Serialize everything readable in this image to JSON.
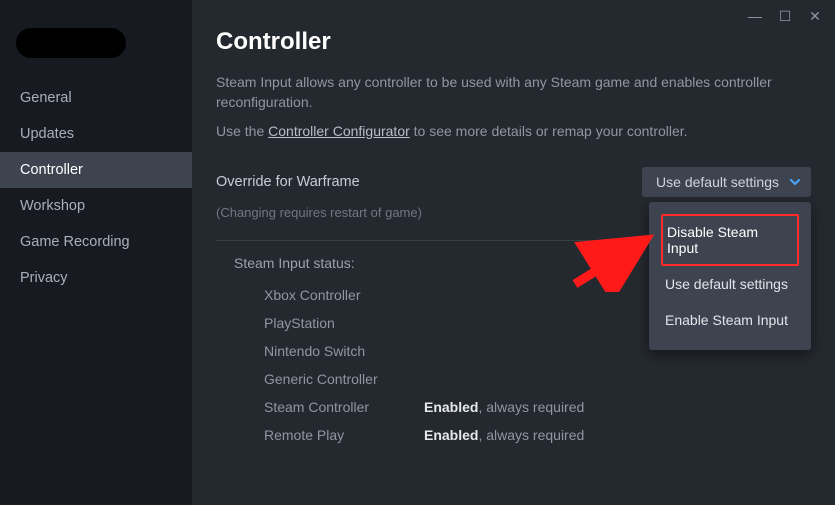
{
  "titlebar": {
    "minimize": "—",
    "maximize": "☐",
    "close": "✕"
  },
  "sidebar": {
    "items": [
      {
        "label": "General"
      },
      {
        "label": "Updates"
      },
      {
        "label": "Controller"
      },
      {
        "label": "Workshop"
      },
      {
        "label": "Game Recording"
      },
      {
        "label": "Privacy"
      }
    ]
  },
  "main": {
    "title": "Controller",
    "desc1": "Steam Input allows any controller to be used with any Steam game and enables controller reconfiguration.",
    "desc2_prefix": "Use the ",
    "desc2_link": "Controller Configurator",
    "desc2_suffix": " to see more details or remap your controller.",
    "override_label": "Override for Warframe",
    "dropdown_selected": "Use default settings",
    "hint": "(Changing requires restart of game)",
    "status_title": "Steam Input status:",
    "status_rows": [
      {
        "name": "Xbox Controller",
        "enabled": "",
        "suffix": ""
      },
      {
        "name": "PlayStation",
        "enabled": "",
        "suffix": ""
      },
      {
        "name": "Nintendo Switch",
        "enabled": "",
        "suffix": ""
      },
      {
        "name": "Generic Controller",
        "enabled": "",
        "suffix": ""
      },
      {
        "name": "Steam Controller",
        "enabled": "Enabled",
        "suffix": ", always required"
      },
      {
        "name": "Remote Play",
        "enabled": "Enabled",
        "suffix": ", always required"
      }
    ]
  },
  "dropdown_menu": {
    "items": [
      {
        "label": "Disable Steam Input"
      },
      {
        "label": "Use default settings"
      },
      {
        "label": "Enable Steam Input"
      }
    ]
  }
}
